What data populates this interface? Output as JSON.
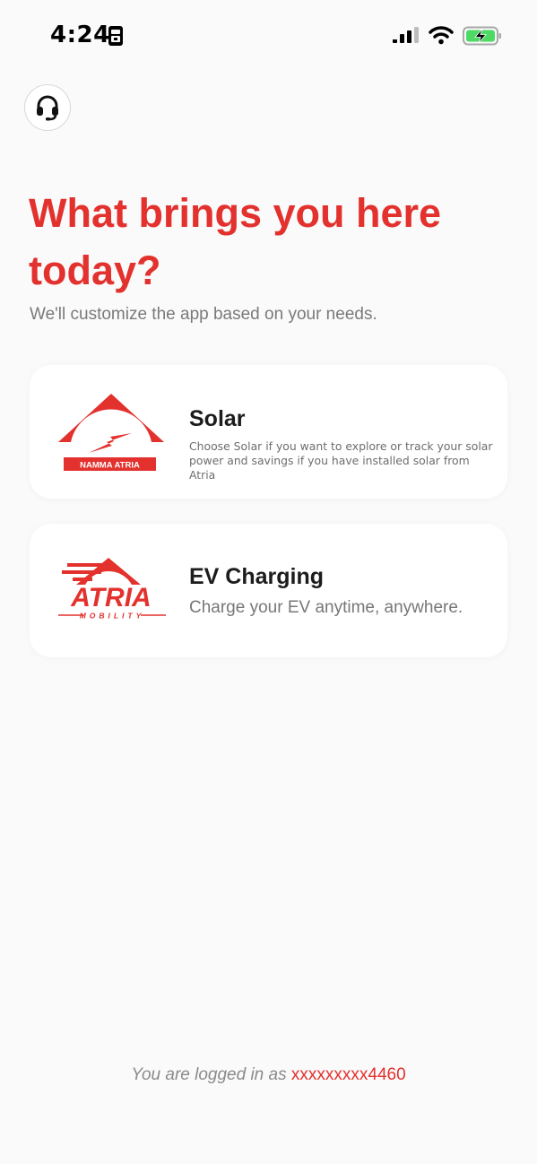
{
  "status_bar": {
    "time": "4:24",
    "icons": [
      "lock-icon",
      "signal-icon",
      "wifi-icon",
      "battery-charging-icon"
    ]
  },
  "support": {
    "icon": "headset-icon"
  },
  "header": {
    "title": "What brings you here today?",
    "subtitle": "We'll customize the app based on your needs."
  },
  "options": [
    {
      "title": "Solar",
      "description": "Choose Solar if you want to explore or track your solar power and savings if you have installed solar from Atria",
      "logo_text": "NAMMA ATRIA"
    },
    {
      "title": "EV Charging",
      "description": "Charge your EV anytime, anywhere.",
      "logo_text": "ATRIA",
      "logo_subtext": "MOBILITY"
    }
  ],
  "footer": {
    "prefix": "You are logged in as",
    "phone": "xxxxxxxxx4460"
  },
  "colors": {
    "accent": "#e3312e",
    "background": "#fafafa",
    "card": "#ffffff",
    "battery": "#4cd964"
  }
}
